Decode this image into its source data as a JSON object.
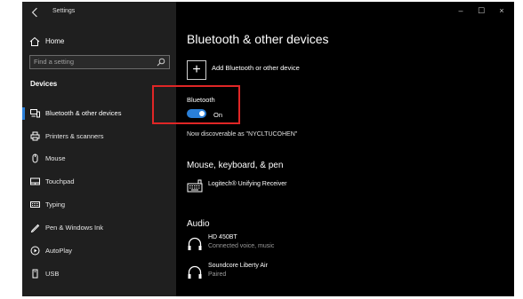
{
  "window": {
    "title": "Settings"
  },
  "sidebar": {
    "home_label": "Home",
    "search_placeholder": "Find a setting",
    "section_heading": "Devices",
    "items": [
      {
        "label": "Bluetooth & other devices",
        "icon": "bluetooth-devices-icon",
        "active": true
      },
      {
        "label": "Printers & scanners",
        "icon": "printer-icon"
      },
      {
        "label": "Mouse",
        "icon": "mouse-icon"
      },
      {
        "label": "Touchpad",
        "icon": "touchpad-icon"
      },
      {
        "label": "Typing",
        "icon": "keyboard-icon"
      },
      {
        "label": "Pen & Windows Ink",
        "icon": "pen-icon"
      },
      {
        "label": "AutoPlay",
        "icon": "autoplay-icon"
      },
      {
        "label": "USB",
        "icon": "usb-icon"
      }
    ]
  },
  "main": {
    "title": "Bluetooth & other devices",
    "add_device_label": "Add Bluetooth or other device",
    "bluetooth": {
      "label": "Bluetooth",
      "state": "On",
      "on": true
    },
    "discoverable_text": "Now discoverable as \"NYCLTUCOHEN\"",
    "mouse_section": {
      "title": "Mouse, keyboard, & pen",
      "devices": [
        {
          "name": "Logitech® Unifying Receiver",
          "status": "",
          "icon": "keyboard-icon"
        }
      ]
    },
    "audio_section": {
      "title": "Audio",
      "devices": [
        {
          "name": "HD 450BT",
          "status": "Connected voice, music",
          "icon": "headphones-icon"
        },
        {
          "name": "Soundcore Liberty Air",
          "status": "Paired",
          "icon": "headphones-icon"
        }
      ]
    }
  },
  "window_controls": {
    "minimize": "–",
    "maximize": "☐",
    "close": "×"
  },
  "colors": {
    "accent": "#2a7fd8",
    "highlight": "#e02626"
  }
}
